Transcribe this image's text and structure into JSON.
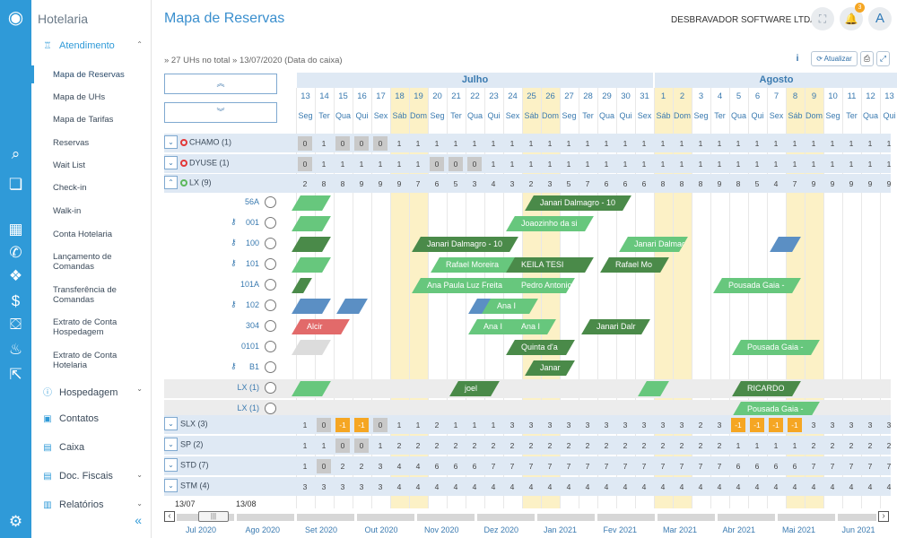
{
  "app": {
    "brand": "Hotelaria"
  },
  "sidebar": {
    "sections": [
      {
        "label": "Atendimento",
        "icon": "bellhop-icon",
        "expanded": true
      },
      {
        "label": "Hospedagem",
        "icon": "bed-icon"
      },
      {
        "label": "Contatos",
        "icon": "contact-icon"
      },
      {
        "label": "Caixa",
        "icon": "cash-icon"
      },
      {
        "label": "Doc. Fiscais",
        "icon": "document-icon"
      },
      {
        "label": "Relatórios",
        "icon": "report-icon"
      }
    ],
    "items": [
      "Mapa de Reservas",
      "Mapa de UHs",
      "Mapa de Tarifas",
      "Reservas",
      "Wait List",
      "Check-in",
      "Walk-in",
      "Conta Hotelaria",
      "Lançamento de Comandas",
      "Transferência de Comandas",
      "Extrato de Conta Hospedagem",
      "Extrato de Conta Hotelaria"
    ],
    "active": "Mapa de Reservas",
    "collapse_glyph": "«"
  },
  "header": {
    "title": "Mapa de Reservas",
    "company": "DESBRAVADOR SOFTWARE LTDA ▾",
    "notifications": "3",
    "avatar": "A",
    "expand_glyph": "⛶",
    "bell_glyph": "🔔"
  },
  "breadcrumb": "» 27 UHs no total » 13/07/2020 (Data do caixa)",
  "toolbar": {
    "info": "i",
    "refresh": "⟳ Atualizar",
    "print": "⎙",
    "fullscreen": "⤢"
  },
  "grid": {
    "up_glyph": "«",
    "down_glyph": "»",
    "months": [
      {
        "name": "Julho",
        "from": 0,
        "to": 19
      },
      {
        "name": "Agosto",
        "from": 19,
        "to": 32
      }
    ],
    "days": [
      "13",
      "14",
      "15",
      "16",
      "17",
      "18",
      "19",
      "20",
      "21",
      "22",
      "23",
      "24",
      "25",
      "26",
      "27",
      "28",
      "29",
      "30",
      "31",
      "1",
      "2",
      "3",
      "4",
      "5",
      "6",
      "7",
      "8",
      "9",
      "10",
      "11",
      "12",
      "13"
    ],
    "weekdays": [
      "Seg",
      "Ter",
      "Qua",
      "Qui",
      "Sex",
      "Sáb",
      "Dom",
      "Seg",
      "Ter",
      "Qua",
      "Qui",
      "Sex",
      "Sáb",
      "Dom",
      "Seg",
      "Ter",
      "Qua",
      "Qui",
      "Sex",
      "Sáb",
      "Dom",
      "Seg",
      "Ter",
      "Qua",
      "Qui",
      "Sex",
      "Sáb",
      "Dom",
      "Seg",
      "Ter",
      "Qua",
      "Qui"
    ],
    "weekend_idx": [
      5,
      6,
      12,
      13,
      19,
      20,
      26,
      27
    ],
    "groups": [
      {
        "name": "CHAMO (1)",
        "dot": "red",
        "counts": [
          "0",
          "1",
          "0",
          "0",
          "0",
          "1",
          "1",
          "1",
          "1",
          "1",
          "1",
          "1",
          "1",
          "1",
          "1",
          "1",
          "1",
          "1",
          "1",
          "1",
          "1",
          "1",
          "1",
          "1",
          "1",
          "1",
          "1",
          "1",
          "1",
          "1",
          "1",
          "1"
        ],
        "zero": [
          0,
          2,
          3,
          4
        ]
      },
      {
        "name": "DYUSE (1)",
        "dot": "red",
        "counts": [
          "0",
          "1",
          "1",
          "1",
          "1",
          "1",
          "1",
          "0",
          "0",
          "0",
          "1",
          "1",
          "1",
          "1",
          "1",
          "1",
          "1",
          "1",
          "1",
          "1",
          "1",
          "1",
          "1",
          "1",
          "1",
          "1",
          "1",
          "1",
          "1",
          "1",
          "1",
          "1"
        ],
        "zero": [
          0,
          7,
          8,
          9
        ]
      },
      {
        "name": "LX (9)",
        "dot": "green",
        "expanded": true,
        "counts": [
          "2",
          "8",
          "8",
          "9",
          "9",
          "9",
          "7",
          "6",
          "5",
          "3",
          "4",
          "3",
          "2",
          "3",
          "5",
          "7",
          "6",
          "6",
          "6",
          "8",
          "8",
          "8",
          "9",
          "8",
          "5",
          "4",
          "7",
          "9",
          "9",
          "9",
          "9",
          "9"
        ],
        "zero": []
      }
    ],
    "rooms": [
      {
        "name": "56A",
        "key": false
      },
      {
        "name": "001",
        "key": true
      },
      {
        "name": "100",
        "key": true
      },
      {
        "name": "101",
        "key": true
      },
      {
        "name": "101A",
        "key": false
      },
      {
        "name": "102",
        "key": true
      },
      {
        "name": "304",
        "key": false
      },
      {
        "name": "0101",
        "key": false
      },
      {
        "name": "B1",
        "key": true
      },
      {
        "name": "LX (1)",
        "key": false
      },
      {
        "name": "LX (1)",
        "key": false
      }
    ],
    "bars": [
      {
        "row": 0,
        "s": -0.3,
        "e": 1.5,
        "c": "#67c77d",
        "t": ""
      },
      {
        "row": 0,
        "s": 12.1,
        "e": 17.5,
        "c": "#4a8a49",
        "t": "Janari Dalmagro - 10"
      },
      {
        "row": 1,
        "s": -0.3,
        "e": 1.5,
        "c": "#67c77d",
        "t": ""
      },
      {
        "row": 1,
        "s": 11.1,
        "e": 15.5,
        "c": "#67c77d",
        "t": "Joaozinho da si"
      },
      {
        "row": 2,
        "s": -0.3,
        "e": 1.5,
        "c": "#4a8a49",
        "t": ""
      },
      {
        "row": 2,
        "s": 6.1,
        "e": 11.5,
        "c": "#4a8a49",
        "t": "Janari Dalmagro - 10"
      },
      {
        "row": 2,
        "s": 17.1,
        "e": 20.5,
        "c": "#67c77d",
        "t": "Janari Dalmagn"
      },
      {
        "row": 2,
        "s": 25.1,
        "e": 26.5,
        "c": "#5b8fc4",
        "t": ""
      },
      {
        "row": 3,
        "s": -0.3,
        "e": 1.5,
        "c": "#67c77d",
        "t": ""
      },
      {
        "row": 3,
        "s": 7.1,
        "e": 11.5,
        "c": "#67c77d",
        "t": "Rafael Moreira"
      },
      {
        "row": 3,
        "s": 11.1,
        "e": 15.5,
        "c": "#4a8a49",
        "t": "KEILA TESI"
      },
      {
        "row": 3,
        "s": 16.1,
        "e": 19.5,
        "c": "#4a8a49",
        "t": "Rafael Mo"
      },
      {
        "row": 4,
        "s": -0.3,
        "e": 0.5,
        "c": "#4a8a49",
        "t": ""
      },
      {
        "row": 4,
        "s": 6.1,
        "e": 11.5,
        "c": "#67c77d",
        "t": "Ana Paula Luz Freita"
      },
      {
        "row": 4,
        "s": 11.1,
        "e": 14.5,
        "c": "#67c77d",
        "t": "Pedro Antonio S"
      },
      {
        "row": 4,
        "s": 22.1,
        "e": 26.5,
        "c": "#67c77d",
        "t": "Pousada Gaia -"
      },
      {
        "row": 5,
        "s": -0.3,
        "e": 1.5,
        "c": "#5b8fc4",
        "t": ""
      },
      {
        "row": 5,
        "s": 2.1,
        "e": 3.5,
        "c": "#5b8fc4",
        "t": ""
      },
      {
        "row": 5,
        "s": 9.1,
        "e": 11.5,
        "c": "#5b8fc4",
        "t": ""
      },
      {
        "row": 5,
        "s": 9.8,
        "e": 12.5,
        "c": "#67c77d",
        "t": "Ana I"
      },
      {
        "row": 6,
        "s": -0.3,
        "e": 2.5,
        "c": "#e26a6a",
        "t": "Alcir"
      },
      {
        "row": 6,
        "s": 9.1,
        "e": 12.5,
        "c": "#67c77d",
        "t": "Ana I"
      },
      {
        "row": 6,
        "s": 11.1,
        "e": 13.5,
        "c": "#67c77d",
        "t": "Ana I"
      },
      {
        "row": 6,
        "s": 15.1,
        "e": 18.5,
        "c": "#4a8a49",
        "t": "Janari Dalr"
      },
      {
        "row": 7,
        "s": -0.3,
        "e": 1.5,
        "c": "#dcdcdc",
        "t": ""
      },
      {
        "row": 7,
        "s": 11.1,
        "e": 14.5,
        "c": "#4a8a49",
        "t": "Quinta d'a"
      },
      {
        "row": 7,
        "s": 23.1,
        "e": 27.5,
        "c": "#67c77d",
        "t": "Pousada Gaia -"
      },
      {
        "row": 8,
        "s": 12.1,
        "e": 14.5,
        "c": "#4a8a49",
        "t": "Janar"
      },
      {
        "row": 9,
        "s": -0.3,
        "e": 1.5,
        "c": "#67c77d",
        "t": ""
      },
      {
        "row": 9,
        "s": 8.1,
        "e": 10.5,
        "c": "#4a8a49",
        "t": "joel"
      },
      {
        "row": 9,
        "s": 18.1,
        "e": 19.5,
        "c": "#67c77d",
        "t": ""
      },
      {
        "row": 9,
        "s": 23.1,
        "e": 26.5,
        "c": "#4a8a49",
        "t": "RICARDO"
      },
      {
        "row": 10,
        "s": 23.1,
        "e": 27.5,
        "c": "#67c77d",
        "t": "Pousada Gaia -"
      }
    ],
    "groups2": [
      {
        "name": "SLX (3)",
        "dot": "none",
        "counts": [
          "1",
          "0",
          "-1",
          "-1",
          "0",
          "1",
          "1",
          "2",
          "1",
          "1",
          "1",
          "3",
          "3",
          "3",
          "3",
          "3",
          "3",
          "3",
          "3",
          "3",
          "3",
          "2",
          "3",
          "-1",
          "-1",
          "-1",
          "-1",
          "3",
          "3",
          "3",
          "3",
          "3"
        ],
        "zero": [
          1,
          4
        ],
        "neg": [
          2,
          3,
          23,
          24,
          25,
          26
        ]
      },
      {
        "name": "SP (2)",
        "dot": "none",
        "counts": [
          "1",
          "1",
          "0",
          "0",
          "1",
          "2",
          "2",
          "2",
          "2",
          "2",
          "2",
          "2",
          "2",
          "2",
          "2",
          "2",
          "2",
          "2",
          "2",
          "2",
          "2",
          "2",
          "2",
          "1",
          "1",
          "1",
          "1",
          "2",
          "2",
          "2",
          "2",
          "2"
        ],
        "zero": [
          2,
          3
        ],
        "neg": []
      },
      {
        "name": "STD (7)",
        "dot": "none",
        "counts": [
          "1",
          "0",
          "2",
          "2",
          "3",
          "4",
          "4",
          "6",
          "6",
          "6",
          "7",
          "7",
          "7",
          "7",
          "7",
          "7",
          "7",
          "7",
          "7",
          "7",
          "7",
          "7",
          "7",
          "6",
          "6",
          "6",
          "6",
          "7",
          "7",
          "7",
          "7",
          "7"
        ],
        "zero": [
          1
        ],
        "neg": []
      },
      {
        "name": "STM (4)",
        "dot": "none",
        "counts": [
          "3",
          "3",
          "3",
          "3",
          "3",
          "4",
          "4",
          "4",
          "4",
          "4",
          "4",
          "4",
          "4",
          "4",
          "4",
          "4",
          "4",
          "4",
          "4",
          "4",
          "4",
          "4",
          "4",
          "4",
          "4",
          "4",
          "4",
          "4",
          "4",
          "4",
          "4",
          "4"
        ],
        "zero": [],
        "neg": []
      }
    ]
  },
  "timeline": {
    "range_from": "13/07",
    "range_to": "13/08",
    "left_arrow": "‹",
    "right_arrow": "›",
    "months": [
      "Jul 2020",
      "Ago 2020",
      "Set 2020",
      "Out 2020",
      "Nov 2020",
      "Dez 2020",
      "Jan 2021",
      "Fev 2021",
      "Mar 2021",
      "Abr 2021",
      "Mai 2021",
      "Jun 2021"
    ]
  }
}
